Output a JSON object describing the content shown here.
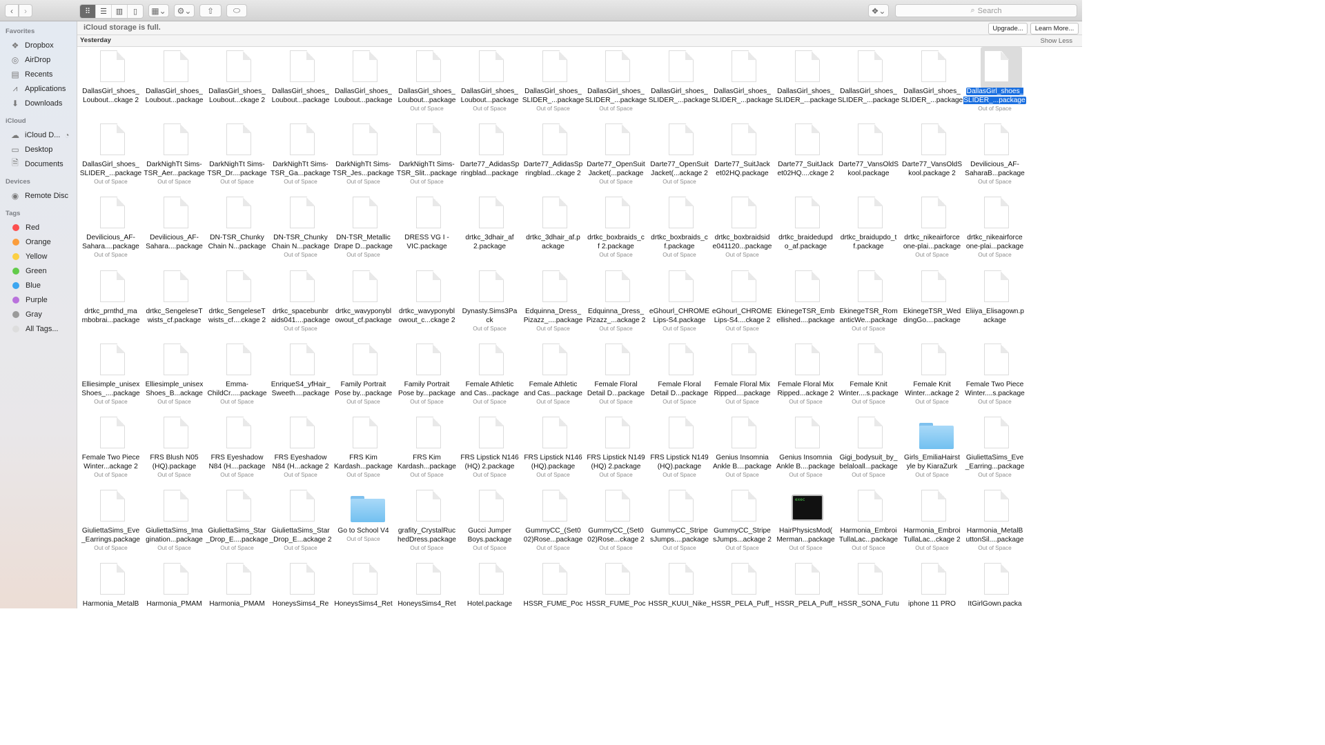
{
  "toolbar": {
    "back_icon": "chevron-left-icon",
    "forward_icon": "chevron-right-icon",
    "view_modes": [
      "icon-view",
      "list-view",
      "column-view",
      "gallery-view"
    ],
    "active_view": "icon-view",
    "search_placeholder": "Search"
  },
  "sidebar": {
    "sections": [
      {
        "title": "Favorites",
        "items": [
          {
            "label": "Dropbox",
            "icon": "dropbox-icon",
            "glyph": "❖"
          },
          {
            "label": "AirDrop",
            "icon": "airdrop-icon",
            "glyph": "◎"
          },
          {
            "label": "Recents",
            "icon": "recents-icon",
            "glyph": "▤"
          },
          {
            "label": "Applications",
            "icon": "applications-icon",
            "glyph": "⩘"
          },
          {
            "label": "Downloads",
            "icon": "downloads-icon",
            "glyph": "⬇"
          }
        ]
      },
      {
        "title": "iCloud",
        "items": [
          {
            "label": "iCloud D...",
            "icon": "icloud-drive-icon",
            "glyph": "☁"
          },
          {
            "label": "Desktop",
            "icon": "desktop-icon",
            "glyph": "▭"
          },
          {
            "label": "Documents",
            "icon": "documents-icon",
            "glyph": "🗎"
          }
        ]
      },
      {
        "title": "Devices",
        "items": [
          {
            "label": "Remote Disc",
            "icon": "remote-disc-icon",
            "glyph": "◉"
          }
        ]
      }
    ],
    "tags_title": "Tags",
    "tags": [
      {
        "label": "Red",
        "color": "#fc4f4f"
      },
      {
        "label": "Orange",
        "color": "#fb9d3c"
      },
      {
        "label": "Yellow",
        "color": "#fbcf43"
      },
      {
        "label": "Green",
        "color": "#62cb4a"
      },
      {
        "label": "Blue",
        "color": "#3ca6f0"
      },
      {
        "label": "Purple",
        "color": "#b972dc"
      },
      {
        "label": "Gray",
        "color": "#9b9b9b"
      },
      {
        "label": "All Tags...",
        "color": "#dddddd"
      }
    ]
  },
  "banner": {
    "message": "iCloud storage is full.",
    "upgrade_label": "Upgrade...",
    "learn_more_label": "Learn More..."
  },
  "group": {
    "title": "Yesterday",
    "show_less_label": "Show Less"
  },
  "status_out_of_space": "Out of Space",
  "files": [
    {
      "name": "DallasGirl_shoes_\nLoubout...ckage 2",
      "oos": false
    },
    {
      "name": "DallasGirl_shoes_\nLoubout...package",
      "oos": false
    },
    {
      "name": "DallasGirl_shoes_\nLoubout...ckage 2",
      "oos": false
    },
    {
      "name": "DallasGirl_shoes_\nLoubout...package",
      "oos": false
    },
    {
      "name": "DallasGirl_shoes_\nLoubout...package",
      "oos": false
    },
    {
      "name": "DallasGirl_shoes_\nLoubout...package",
      "oos": true
    },
    {
      "name": "DallasGirl_shoes_\nLoubout...package",
      "oos": true
    },
    {
      "name": "DallasGirl_shoes_\nSLIDER_...package",
      "oos": true
    },
    {
      "name": "DallasGirl_shoes_\nSLIDER_...package",
      "oos": true
    },
    {
      "name": "DallasGirl_shoes_\nSLIDER_...package",
      "oos": false
    },
    {
      "name": "DallasGirl_shoes_\nSLIDER_...package",
      "oos": false
    },
    {
      "name": "DallasGirl_shoes_\nSLIDER_...package",
      "oos": false
    },
    {
      "name": "DallasGirl_shoes_\nSLIDER_...package",
      "oos": false
    },
    {
      "name": "DallasGirl_shoes_\nSLIDER_...package",
      "oos": false
    },
    {
      "name": "DallasGirl_shoes_\nSLIDER_...package",
      "oos": true,
      "selected": true
    },
    {
      "name": "DallasGirl_shoes_\nSLIDER_...package",
      "oos": true
    },
    {
      "name": "DarkNighTt Sims-\nTSR_Aer...package",
      "oos": true
    },
    {
      "name": "DarkNighTt Sims-\nTSR_Dr....package",
      "oos": true
    },
    {
      "name": "DarkNighTt Sims-\nTSR_Ga...package",
      "oos": true
    },
    {
      "name": "DarkNighTt Sims-\nTSR_Jes...package",
      "oos": true
    },
    {
      "name": "DarkNighTt Sims-\nTSR_Slit...package",
      "oos": true
    },
    {
      "name": "Darte77_AdidasSp\nringblad...package",
      "oos": false
    },
    {
      "name": "Darte77_AdidasSp\nringblad...ckage 2",
      "oos": false
    },
    {
      "name": "Darte77_OpenSuit\nJacket(...package",
      "oos": true
    },
    {
      "name": "Darte77_OpenSuit\nJacket(...ackage 2",
      "oos": true
    },
    {
      "name": "Darte77_SuitJack\net02HQ.package",
      "oos": false
    },
    {
      "name": "Darte77_SuitJack\net02HQ....ckage 2",
      "oos": false
    },
    {
      "name": "Darte77_VansOldS\nkool.package",
      "oos": false
    },
    {
      "name": "Darte77_VansOldS\nkool.package 2",
      "oos": false
    },
    {
      "name": "Devilicious_AF-\nSaharaB...package",
      "oos": true
    },
    {
      "name": "Devilicious_AF-\nSahara....package",
      "oos": true
    },
    {
      "name": "Devilicious_AF-\nSahara....package",
      "oos": false
    },
    {
      "name": "DN-TSR_Chunky\nChain N...package",
      "oos": false
    },
    {
      "name": "DN-TSR_Chunky\nChain N...package",
      "oos": true
    },
    {
      "name": "DN-TSR_Metallic\nDrape D...package",
      "oos": true
    },
    {
      "name": "DRESS VG I -\nVIC.package",
      "oos": false
    },
    {
      "name": "drtkc_3dhair_af\n2.package",
      "oos": false
    },
    {
      "name": "drtkc_3dhair_af.p\nackage",
      "oos": false
    },
    {
      "name": "drtkc_boxbraids_c\nf 2.package",
      "oos": true
    },
    {
      "name": "drtkc_boxbraids_c\nf.package",
      "oos": true
    },
    {
      "name": "drtkc_boxbraidsid\ne041120...package",
      "oos": true
    },
    {
      "name": "drtkc_braidedupd\no_af.package",
      "oos": false
    },
    {
      "name": "drtkc_braidupdo_t\nf.package",
      "oos": false
    },
    {
      "name": "drtkc_nikeairforce\none-plai...package",
      "oos": true
    },
    {
      "name": "drtkc_nikeairforce\none-plai...package",
      "oos": true
    },
    {
      "name": "drtkc_prnthd_ma\nmbobrai...package",
      "oos": false
    },
    {
      "name": "drtkc_SengeleseT\nwists_cf.package",
      "oos": false
    },
    {
      "name": "drtkc_SengeleseT\nwists_cf....ckage 2",
      "oos": false
    },
    {
      "name": "drtkc_spacebunbr\naids041....package",
      "oos": true
    },
    {
      "name": "drtkc_wavyponybl\nowout_cf.package",
      "oos": false
    },
    {
      "name": "drtkc_wavyponybl\nowout_c...ckage 2",
      "oos": false
    },
    {
      "name": "Dynasty.Sims3Pa\nck",
      "oos": true
    },
    {
      "name": "Edquinna_Dress_\nPizazz_....package",
      "oos": true
    },
    {
      "name": "Edquinna_Dress_\nPizazz_...ackage 2",
      "oos": true
    },
    {
      "name": "eGhourl_CHROME\nLips-S4.package",
      "oos": true
    },
    {
      "name": "eGhourl_CHROME\nLips-S4....ckage 2",
      "oos": true
    },
    {
      "name": "EkinegeTSR_Emb\nellished....package",
      "oos": false
    },
    {
      "name": "EkinegeTSR_Rom\nanticWe...package",
      "oos": true
    },
    {
      "name": "EkinegeTSR_Wed\ndingGo....package",
      "oos": false
    },
    {
      "name": "Eliiya_Elisagown.p\nackage",
      "oos": false
    },
    {
      "name": "Elliesimple_unisex\nShoes_....package",
      "oos": true
    },
    {
      "name": "Elliesimple_unisex\nShoes_B...ackage",
      "oos": true
    },
    {
      "name": "Emma-\nChildCr.....package",
      "oos": true
    },
    {
      "name": "EnriqueS4_yfHair_\nSweeth....package",
      "oos": false
    },
    {
      "name": "Family Portrait\nPose by...package",
      "oos": true
    },
    {
      "name": "Family Portrait\nPose by...package",
      "oos": true
    },
    {
      "name": "Female Athletic\nand Cas...package",
      "oos": true
    },
    {
      "name": "Female Athletic\nand Cas...package",
      "oos": true
    },
    {
      "name": "Female Floral\nDetail D...package",
      "oos": true
    },
    {
      "name": "Female Floral\nDetail D...package",
      "oos": true
    },
    {
      "name": "Female Floral Mix\nRipped....package",
      "oos": true
    },
    {
      "name": "Female Floral Mix\nRipped...ackage 2",
      "oos": true
    },
    {
      "name": "Female Knit\nWinter....s.package",
      "oos": true
    },
    {
      "name": "Female Knit\nWinter...ackage 2",
      "oos": true
    },
    {
      "name": "Female Two Piece\nWinter....s.package",
      "oos": true
    },
    {
      "name": "Female Two Piece\nWinter...ackage 2",
      "oos": true
    },
    {
      "name": "FRS Blush N05\n(HQ).package",
      "oos": true
    },
    {
      "name": "FRS Eyeshadow\nN84 (H....package",
      "oos": true
    },
    {
      "name": "FRS Eyeshadow\nN84 (H...ackage 2",
      "oos": true
    },
    {
      "name": "FRS Kim\nKardash...package",
      "oos": true
    },
    {
      "name": "FRS Kim\nKardash...package",
      "oos": true
    },
    {
      "name": "FRS Lipstick N146\n(HQ) 2.package",
      "oos": true
    },
    {
      "name": "FRS Lipstick N146\n(HQ).package",
      "oos": true
    },
    {
      "name": "FRS Lipstick N149\n(HQ) 2.package",
      "oos": true
    },
    {
      "name": "FRS Lipstick N149\n(HQ).package",
      "oos": true
    },
    {
      "name": "Genius Insomnia\nAnkle B....package",
      "oos": true
    },
    {
      "name": "Genius Insomnia\nAnkle B....package",
      "oos": true
    },
    {
      "name": "Gigi_bodysuit_by_\nbelaloall...package",
      "oos": true
    },
    {
      "name": "Girls_EmiliaHairst\nyle by KiaraZurk",
      "oos": true,
      "kind": "folder"
    },
    {
      "name": "GiuliettaSims_Eve\n_Earring...package",
      "oos": true
    },
    {
      "name": "GiuliettaSims_Eve\n_Earrings.package",
      "oos": true
    },
    {
      "name": "GiuliettaSims_Ima\ngination...package",
      "oos": true
    },
    {
      "name": "GiuliettaSims_Star\n_Drop_E....package",
      "oos": true
    },
    {
      "name": "GiuliettaSims_Star\n_Drop_E...ackage 2",
      "oos": true
    },
    {
      "name": "Go to School V4",
      "oos": true,
      "kind": "folder"
    },
    {
      "name": "grafity_CrystalRuc\nhedDress.package",
      "oos": true
    },
    {
      "name": "Gucci Jumper\nBoys.package",
      "oos": true
    },
    {
      "name": "GummyCC_(Set0\n02)Rose...package",
      "oos": true
    },
    {
      "name": "GummyCC_(Set0\n02)Rose...ckage 2",
      "oos": true
    },
    {
      "name": "GummyCC_Stripe\nsJumps....package",
      "oos": true
    },
    {
      "name": "GummyCC_Stripe\nsJumps...ackage 2",
      "oos": true
    },
    {
      "name": "HairPhysicsMod(\nMerman...package",
      "oos": true,
      "kind": "exec"
    },
    {
      "name": "Harmonia_Embroi\nTullaLac...package",
      "oos": true
    },
    {
      "name": "Harmonia_Embroi\nTullaLac...ckage 2",
      "oos": true
    },
    {
      "name": "Harmonia_MetalB\nuttonSil....package",
      "oos": true
    },
    {
      "name": "Harmonia_MetalB",
      "oos": false
    },
    {
      "name": "Harmonia_PMAM",
      "oos": false
    },
    {
      "name": "Harmonia_PMAM",
      "oos": false
    },
    {
      "name": "HoneysSims4_Re",
      "oos": false
    },
    {
      "name": "HoneysSims4_Ret",
      "oos": false
    },
    {
      "name": "HoneysSims4_Ret",
      "oos": false
    },
    {
      "name": "Hotel.package",
      "oos": false
    },
    {
      "name": "HSSR_FUME_Poc",
      "oos": false
    },
    {
      "name": "HSSR_FUME_Poc",
      "oos": false
    },
    {
      "name": "HSSR_KUUI_Nike_",
      "oos": false
    },
    {
      "name": "HSSR_PELA_Puff_",
      "oos": false
    },
    {
      "name": "HSSR_PELA_Puff_",
      "oos": false
    },
    {
      "name": "HSSR_SONA_Futu",
      "oos": false
    },
    {
      "name": "iphone 11 PRO",
      "oos": false
    },
    {
      "name": "ItGirlGown.packa",
      "oos": false
    }
  ]
}
